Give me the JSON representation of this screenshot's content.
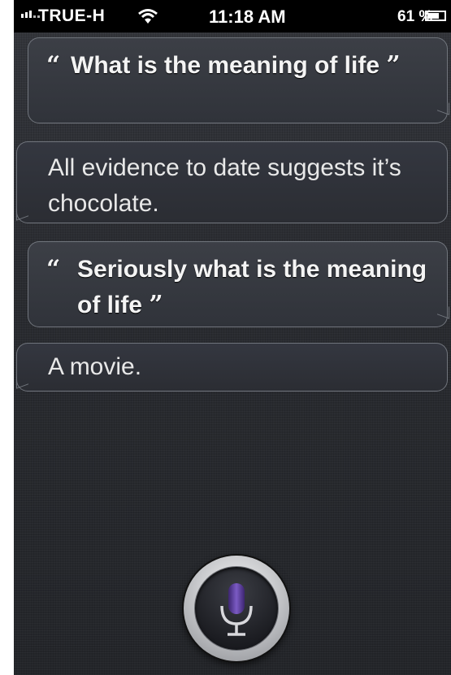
{
  "status_bar": {
    "carrier": "TRUE-H",
    "time": "11:18 AM",
    "battery": "61 %",
    "signal_icon": "signal-bars-icon",
    "wifi_icon": "wifi-icon",
    "battery_icon": "battery-icon"
  },
  "conversation": [
    {
      "speaker": "user",
      "open_quote": "“",
      "text": "What is the meaning of life",
      "close_quote": "”"
    },
    {
      "speaker": "siri",
      "text": "All evidence to date suggests it’s chocolate."
    },
    {
      "speaker": "user",
      "open_quote": "“",
      "text": "Seriously what is the meaning of life",
      "close_quote": "”"
    },
    {
      "speaker": "siri",
      "text": "A movie."
    }
  ],
  "mic": {
    "icon": "microphone-icon",
    "accent": "#5b3a9a"
  }
}
